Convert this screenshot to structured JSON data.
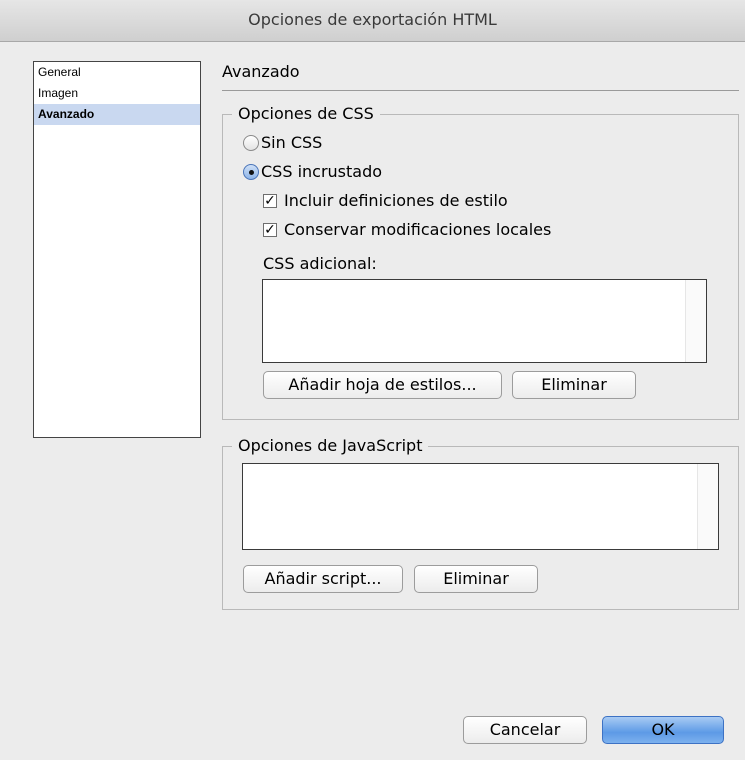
{
  "window": {
    "title": "Opciones de exportación HTML"
  },
  "sidebar": {
    "items": [
      {
        "label": "General",
        "selected": false
      },
      {
        "label": "Imagen",
        "selected": false
      },
      {
        "label": "Avanzado",
        "selected": true
      }
    ]
  },
  "section": {
    "title": "Avanzado"
  },
  "css_options": {
    "legend": "Opciones de CSS",
    "radio_none": {
      "label": "Sin CSS",
      "selected": false
    },
    "radio_embedded": {
      "label": "CSS incrustado",
      "selected": true
    },
    "check_styles": {
      "label": "Incluir definiciones de estilo",
      "checked": true
    },
    "check_local": {
      "label": "Conservar modificaciones locales",
      "checked": true
    },
    "additional_label": "CSS adicional:",
    "add_button": "Añadir hoja de estilos...",
    "remove_button": "Eliminar"
  },
  "js_options": {
    "legend": "Opciones de JavaScript",
    "add_button": "Añadir script...",
    "remove_button": "Eliminar"
  },
  "footer": {
    "cancel_button": "Cancelar",
    "ok_button": "OK"
  },
  "icons": {
    "checkbox_mark": "✓"
  },
  "colors": {
    "selection": "#c9d8f0",
    "primary_button": "#5d9ae6",
    "window_bg": "#ececec"
  }
}
